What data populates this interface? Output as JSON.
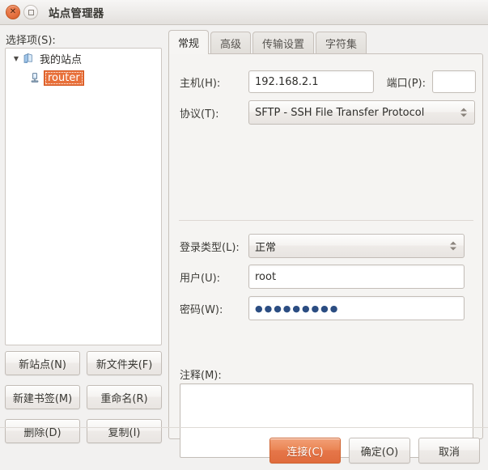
{
  "window": {
    "title": "站点管理器",
    "close_icon": "close-icon",
    "maximize_icon": "maximize-icon"
  },
  "left_pane": {
    "selection_label": "选择项(S):",
    "tree": [
      {
        "label": "我的站点",
        "icon": "folder-site-icon",
        "expander": "▼",
        "selected": false
      },
      {
        "label": "router",
        "icon": "server-icon",
        "expander": "",
        "selected": true
      }
    ],
    "buttons": [
      "新站点(N)",
      "新文件夹(F)",
      "新建书签(M)",
      "重命名(R)",
      "删除(D)",
      "复制(I)"
    ]
  },
  "notebook": {
    "tabs": [
      {
        "label": "常规",
        "active": true
      },
      {
        "label": "高级",
        "active": false
      },
      {
        "label": "传输设置",
        "active": false
      },
      {
        "label": "字符集",
        "active": false
      }
    ]
  },
  "general_tab": {
    "host_label": "主机(H):",
    "host_value": "192.168.2.1",
    "port_label": "端口(P):",
    "port_value": "",
    "protocol_label": "协议(T):",
    "protocol_value": "SFTP - SSH File Transfer Protocol",
    "logon_type_label": "登录类型(L):",
    "logon_type_value": "正常",
    "user_label": "用户(U):",
    "user_value": "root",
    "password_label": "密码(W):",
    "password_value": "●●●●●●●●●",
    "notes_label": "注释(M):",
    "notes_value": ""
  },
  "dialog_buttons": {
    "connect": "连接(C)",
    "ok": "确定(O)",
    "cancel": "取消"
  },
  "colors": {
    "accent_orange": "#e6764a",
    "selection_orange": "#e8703a",
    "window_bg": "#f2f1f0",
    "field_bg": "#ffffff"
  }
}
